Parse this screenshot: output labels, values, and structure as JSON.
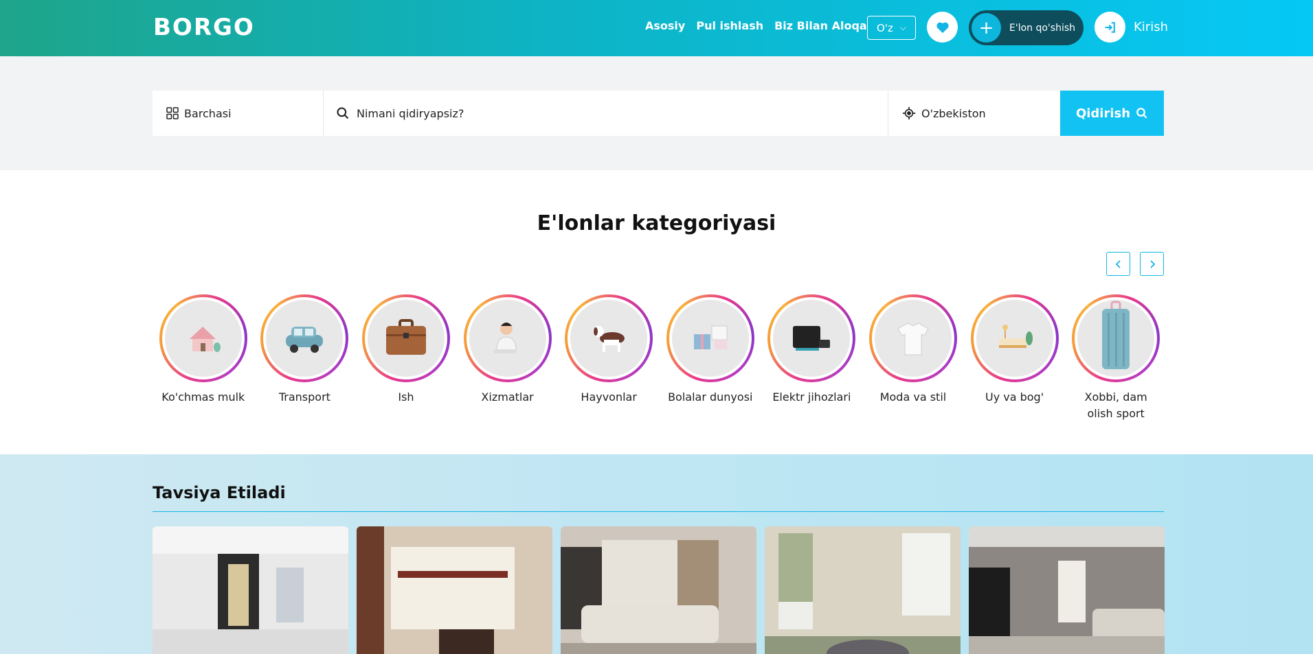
{
  "header": {
    "logo": "BORGO",
    "nav": [
      "Asosiy",
      "Pul ishlash",
      "Biz Bilan Aloqa"
    ],
    "language": "O'z",
    "add_listing_label": "E'lon qo'shish",
    "login_label": "Kirish"
  },
  "search": {
    "category_value": "Barchasi",
    "query_placeholder": "Nimani qidiryapsiz?",
    "location_value": "O'zbekiston",
    "button_label": "Qidirish"
  },
  "categories": {
    "title": "E'lonlar kategoriyasi",
    "items": [
      {
        "label": "Ko'chmas mulk",
        "icon": "house-icon"
      },
      {
        "label": "Transport",
        "icon": "car-icon"
      },
      {
        "label": "Ish",
        "icon": "briefcase-icon"
      },
      {
        "label": "Xizmatlar",
        "icon": "person-icon"
      },
      {
        "label": "Hayvonlar",
        "icon": "dog-icon"
      },
      {
        "label": "Bolalar dunyosi",
        "icon": "gift-box-icon"
      },
      {
        "label": "Elektr jihozlari",
        "icon": "tablet-icon"
      },
      {
        "label": "Moda va stil",
        "icon": "tshirt-icon"
      },
      {
        "label": "Uy va bog'",
        "icon": "sofa-icon"
      },
      {
        "label": "Xobbi, dam olish sport",
        "icon": "suitcase-icon"
      }
    ]
  },
  "recommended": {
    "title": "Tavsiya Etiladi",
    "cards": [
      {
        "name": "listing-photo-1"
      },
      {
        "name": "listing-photo-2"
      },
      {
        "name": "listing-photo-3"
      },
      {
        "name": "listing-photo-4"
      },
      {
        "name": "listing-photo-5"
      }
    ]
  },
  "colors": {
    "accent": "#12c2f2",
    "header_start": "#1ea58a",
    "header_end": "#06c8f5",
    "add_button": "#0d4d5c"
  }
}
